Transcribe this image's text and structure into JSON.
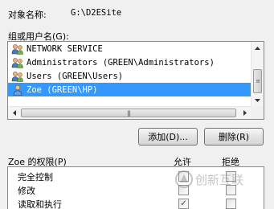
{
  "object_name": {
    "label": "对象名称:",
    "value": "G:\\D2ESite"
  },
  "groups": {
    "label": "组或用户名(G):",
    "items": [
      {
        "label": "NETWORK SERVICE",
        "icon": "users-group-icon",
        "selected": false
      },
      {
        "label": "Administrators (GREEN\\Administrators)",
        "icon": "users-group-icon",
        "selected": false
      },
      {
        "label": "Users (GREEN\\Users)",
        "icon": "users-group-icon",
        "selected": false
      },
      {
        "label": "Zoe (GREEN\\HP)",
        "icon": "user-icon",
        "selected": true
      }
    ]
  },
  "buttons": {
    "add": "添加(D)...",
    "remove": "删除(R)"
  },
  "permissions": {
    "label": "Zoe 的权限(P)",
    "allow_label": "允许",
    "deny_label": "拒绝",
    "rows": [
      {
        "name": "完全控制",
        "allow": false,
        "deny": false
      },
      {
        "name": "修改",
        "allow": false,
        "deny": false
      },
      {
        "name": "读取和执行",
        "allow": true,
        "deny": false
      }
    ]
  },
  "watermark": "创新互联",
  "colors": {
    "selection": "#3399ff",
    "window_bg": "#f0f0f0"
  }
}
